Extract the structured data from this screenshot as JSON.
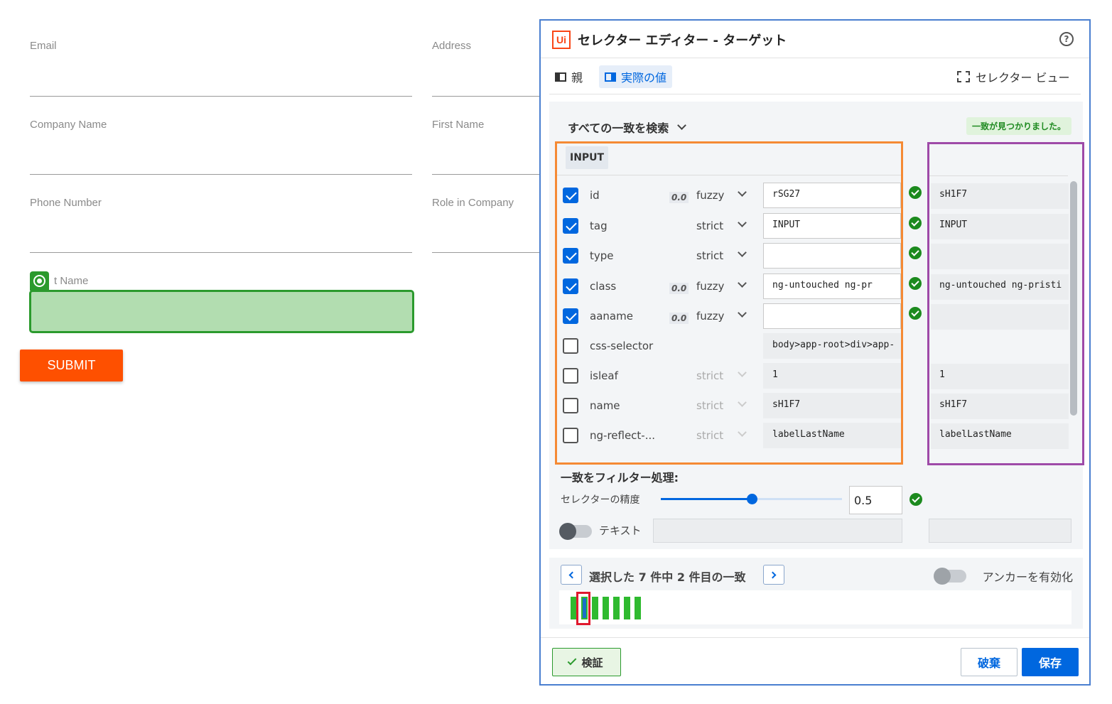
{
  "form": {
    "email_label": "Email",
    "address_label": "Address",
    "company_label": "Company Name",
    "first_name_label": "First Name",
    "phone_label": "Phone Number",
    "role_label": "Role in Company",
    "last_name_label": "t Name",
    "submit_label": "SUBMIT",
    "accent_color": "#fe5000",
    "highlight_color": "#2b9a2d"
  },
  "dialog": {
    "logo": "Ui",
    "title": "セレクター エディター - ターゲット",
    "help_icon": "?",
    "tabs": {
      "parent": "親",
      "actual": "実際の値",
      "selector_view": "セレクター ビュー"
    },
    "search_all": "すべての一致を検索",
    "found_badge": "一致が見つかりました。",
    "element_tag": "INPUT",
    "attributes": [
      {
        "name": "id",
        "checked": true,
        "accuracy": "0.0",
        "match": "fuzzy",
        "value": "rSG27",
        "ok": true,
        "actual": "sH1F7"
      },
      {
        "name": "tag",
        "checked": true,
        "accuracy": "",
        "match": "strict",
        "value": "INPUT",
        "ok": true,
        "actual": "INPUT"
      },
      {
        "name": "type",
        "checked": true,
        "accuracy": "",
        "match": "strict",
        "value": "",
        "ok": true,
        "actual": ""
      },
      {
        "name": "class",
        "checked": true,
        "accuracy": "0.0",
        "match": "fuzzy",
        "value": "ng-untouched ng-pr",
        "ok": true,
        "actual": "ng-untouched ng-pristi"
      },
      {
        "name": "aaname",
        "checked": true,
        "accuracy": "0.0",
        "match": "fuzzy",
        "value": "",
        "ok": true,
        "actual": ""
      },
      {
        "name": "css-selector",
        "checked": false,
        "accuracy": "",
        "match": "",
        "value": "body>app-root>div>app-",
        "ok": false,
        "actual": ""
      },
      {
        "name": "isleaf",
        "checked": false,
        "accuracy": "",
        "match": "strict",
        "value": "1",
        "ok": false,
        "actual": "1"
      },
      {
        "name": "name",
        "checked": false,
        "accuracy": "",
        "match": "strict",
        "value": "sH1F7",
        "ok": false,
        "actual": "sH1F7"
      },
      {
        "name": "ng-reflect-...",
        "checked": false,
        "accuracy": "",
        "match": "strict",
        "value": "labelLastName",
        "ok": false,
        "actual": "labelLastName"
      }
    ],
    "filter_title": "一致をフィルター処理:",
    "precision_label": "セレクターの精度",
    "precision_value": "0.5",
    "precision_fraction": 0.5,
    "text_toggle_label": "テキスト",
    "match_nav": "選択した 7 件中 2 件目の一致",
    "anchor_label": "アンカーを有効化",
    "match_total": 7,
    "match_selected": 2,
    "verify_label": "検証",
    "discard_label": "破棄",
    "save_label": "保存",
    "primary_color": "#0067df"
  }
}
